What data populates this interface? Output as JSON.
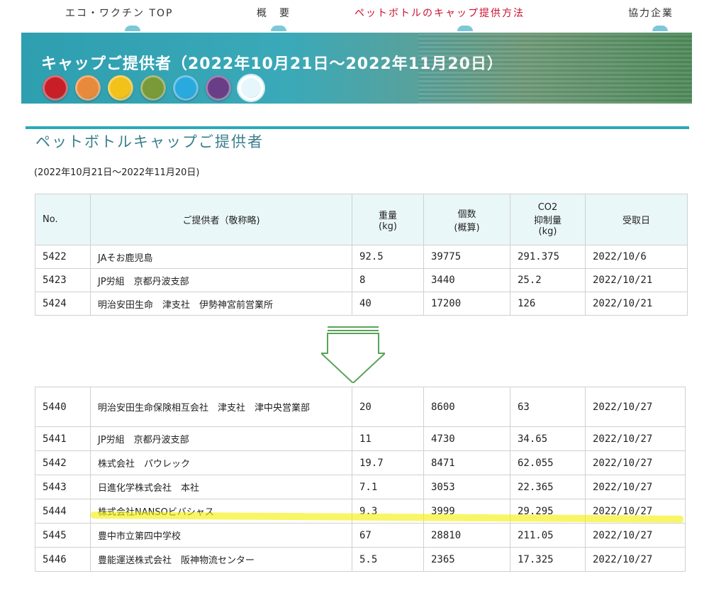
{
  "nav": {
    "items": [
      {
        "label": "エコ・ワクチン TOP",
        "active": false
      },
      {
        "label": "概　要",
        "active": false
      },
      {
        "label": "ペットボトルのキャップ提供方法",
        "active": true
      },
      {
        "label": "協力企業",
        "active": false
      }
    ]
  },
  "banner": {
    "title": "キャップご提供者（2022年10月21日～2022年11月20日）",
    "cap_colors": [
      "#c81e28",
      "#e98a3a",
      "#f2c21a",
      "#7a9a3a",
      "#2aa9df",
      "#6a3e86",
      "#e6f7fb"
    ]
  },
  "section": {
    "title": "ペットボトルキャップご提供者",
    "period": "(2022年10月21日～2022年11月20日)"
  },
  "table": {
    "headers": [
      "No.",
      "ご提供者（敬称略)",
      "重量\n(kg)",
      "個数\n(概算)",
      "CO2\n抑制量\n(kg)",
      "受取日"
    ],
    "rows_top": [
      [
        "5422",
        "JAそお鹿児島",
        "92.5",
        "39775",
        "291.375",
        "2022/10/6"
      ],
      [
        "5423",
        "JP労組　京都丹波支部",
        "8",
        "3440",
        "25.2",
        "2022/10/21"
      ],
      [
        "5424",
        "明治安田生命　津支社　伊勢神宮前営業所",
        "40",
        "17200",
        "126",
        "2022/10/21"
      ]
    ],
    "rows_bottom": [
      [
        "5440",
        "明治安田生命保険相互会社　津支社　津中央営業部",
        "20",
        "8600",
        "63",
        "2022/10/27"
      ],
      [
        "5441",
        "JP労組　京都丹波支部",
        "11",
        "4730",
        "34.65",
        "2022/10/27"
      ],
      [
        "5442",
        "株式会社　パウレック",
        "19.7",
        "8471",
        "62.055",
        "2022/10/27"
      ],
      [
        "5443",
        "日進化学株式会社　本社",
        "7.1",
        "3053",
        "22.365",
        "2022/10/27"
      ],
      [
        "5444",
        "株式会社NANSOビバシャス",
        "9.3",
        "3999",
        "29.295",
        "2022/10/27"
      ],
      [
        "5445",
        "豊中市立第四中学校",
        "67",
        "28810",
        "211.05",
        "2022/10/27"
      ],
      [
        "5446",
        "豊能運送株式会社　阪神物流センター",
        "5.5",
        "2365",
        "17.325",
        "2022/10/27"
      ]
    ]
  },
  "colors": {
    "accent": "#2aaab8",
    "nav_active": "#c8102e",
    "highlight": "#f4f000"
  }
}
